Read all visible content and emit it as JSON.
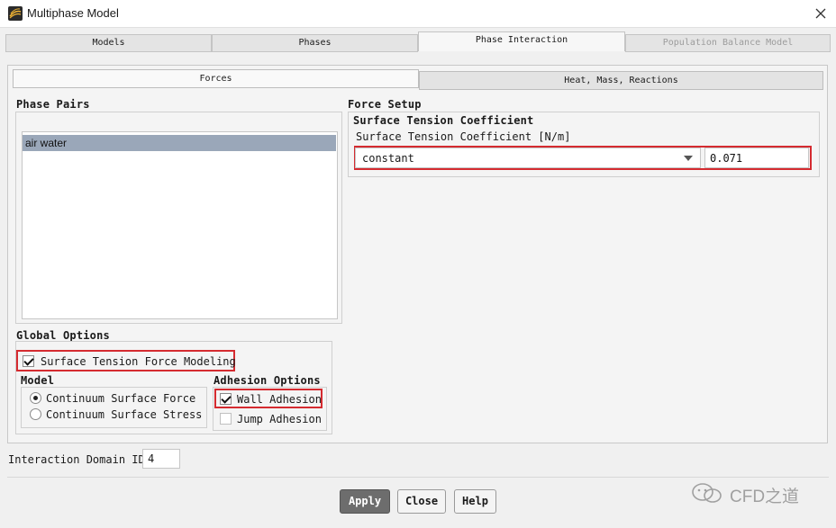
{
  "window": {
    "title": "Multiphase Model"
  },
  "tabs": [
    {
      "label": "Models",
      "active": false,
      "enabled": true
    },
    {
      "label": "Phases",
      "active": false,
      "enabled": true
    },
    {
      "label": "Phase Interaction",
      "active": true,
      "enabled": true
    },
    {
      "label": "Population Balance Model",
      "active": false,
      "enabled": false
    }
  ],
  "subtabs": [
    {
      "label": "Forces",
      "active": true
    },
    {
      "label": "Heat, Mass, Reactions",
      "active": false
    }
  ],
  "phase_pairs": {
    "title": "Phase Pairs",
    "items": [
      "air water"
    ],
    "selected": "air water"
  },
  "force_setup": {
    "title": "Force Setup",
    "group_title": "Surface Tension Coefficient",
    "field_label": "Surface Tension Coefficient [N/m]",
    "method": "constant",
    "value": "0.071"
  },
  "global_options": {
    "title": "Global Options",
    "surface_tension_label": "Surface Tension Force Modeling",
    "surface_tension_checked": true
  },
  "model": {
    "title": "Model",
    "options": [
      {
        "label": "Continuum Surface Force",
        "selected": true
      },
      {
        "label": "Continuum Surface Stress",
        "selected": false
      }
    ]
  },
  "adhesion_options": {
    "title": "Adhesion Options",
    "wall_adhesion_label": "Wall Adhesion",
    "wall_adhesion_checked": true,
    "jump_adhesion_label": "Jump Adhesion",
    "jump_adhesion_checked": false
  },
  "interaction_domain": {
    "label": "Interaction Domain ID",
    "value": "4"
  },
  "buttons": {
    "apply": "Apply",
    "close": "Close",
    "help": "Help"
  },
  "watermark": {
    "text": "CFD之道"
  },
  "colors": {
    "highlight_red": "#d52b30",
    "selection": "#9aa7b9",
    "primary_button": "#6d6d6d"
  }
}
